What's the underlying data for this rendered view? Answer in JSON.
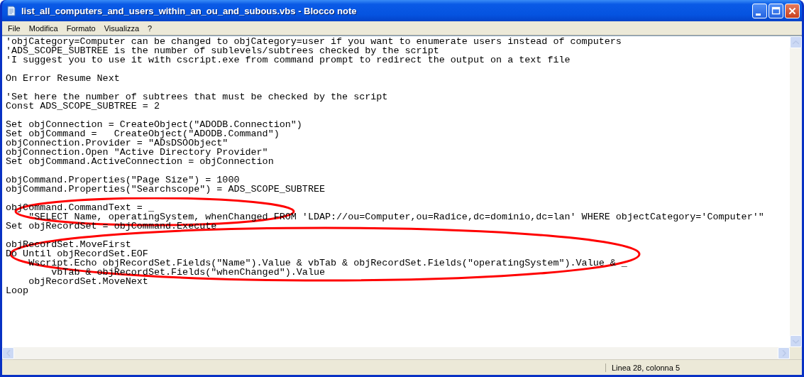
{
  "window": {
    "title": "list_all_computers_and_users_within_an_ou_and_subous.vbs - Blocco note"
  },
  "menu": [
    "File",
    "Modifica",
    "Formato",
    "Visualizza",
    "?"
  ],
  "editor": {
    "blocks": [
      [
        "'objCategory=Computer can be changed to objCategory=user if you want to enumerate users instead of computers",
        "'ADS_SCOPE_SUBTREE is the number of sublevels/subtrees checked by the script",
        "'I suggest you to use it with cscript.exe from command prompt to redirect the output on a text file"
      ],
      [
        "On Error Resume Next"
      ],
      [
        "'Set here the number of subtrees that must be checked by the script",
        "Const ADS_SCOPE_SUBTREE = 2"
      ],
      [
        "Set objConnection = CreateObject(\"ADODB.Connection\")",
        "Set objCommand =   CreateObject(\"ADODB.Command\")",
        "objConnection.Provider = \"ADsDSOObject\"",
        "objConnection.Open \"Active Directory Provider\"",
        "Set objCommand.ActiveConnection = objConnection"
      ],
      [
        "objCommand.Properties(\"Page Size\") = 1000",
        "objCommand.Properties(\"Searchscope\") = ADS_SCOPE_SUBTREE"
      ],
      [
        "objCommand.CommandText = _",
        "    \"SELECT Name, operatingSystem, whenChanged FROM 'LDAP://ou=Computer,ou=Radice,dc=dominio,dc=lan' WHERE objectCategory='Computer'\"",
        "Set objRecordSet = objCommand.Execute"
      ],
      [
        "objRecordSet.MoveFirst",
        "Do Until objRecordSet.EOF",
        "    Wscript.Echo objRecordSet.Fields(\"Name\").Value & vbTab & objRecordSet.Fields(\"operatingSystem\").Value & _",
        "        vbTab & objRecordSet.Fields(\"whenChanged\").Value",
        "    objRecordSet.MoveNext",
        "Loop"
      ]
    ]
  },
  "status_bar": {
    "position": "Linea 28, colonna 5"
  }
}
